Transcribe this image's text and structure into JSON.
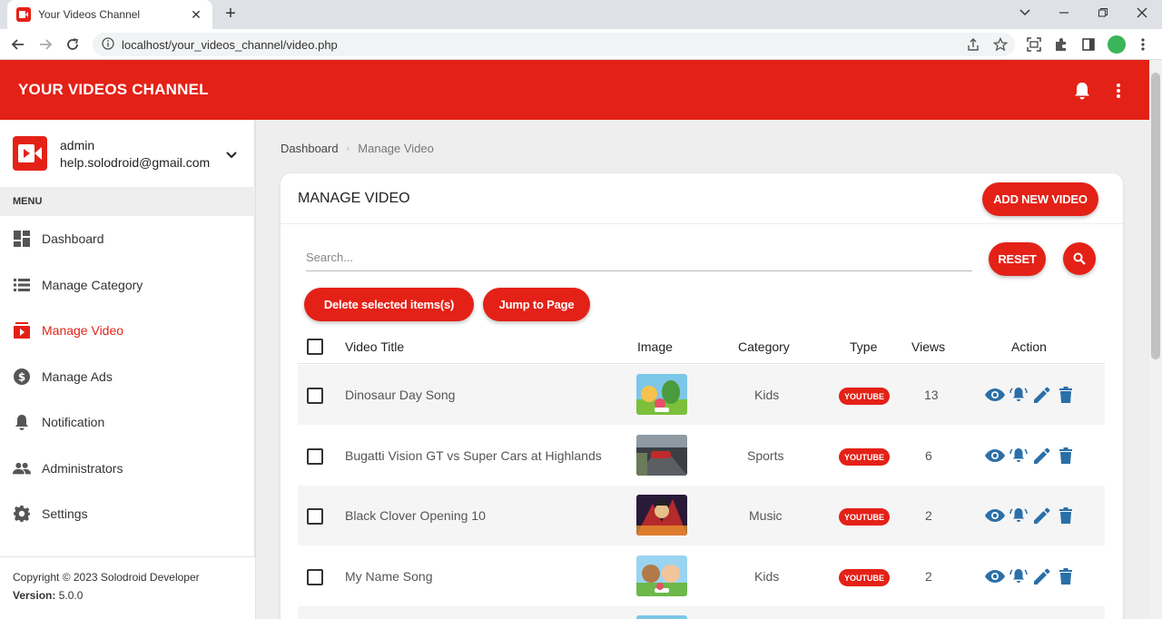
{
  "browser": {
    "tab_title": "Your Videos Channel",
    "url": "localhost/your_videos_channel/video.php"
  },
  "header": {
    "title": "YOUR VIDEOS CHANNEL"
  },
  "user": {
    "name": "admin",
    "email": "help.solodroid@gmail.com"
  },
  "sidebar": {
    "menu_header": "MENU",
    "items": [
      {
        "label": "Dashboard"
      },
      {
        "label": "Manage Category"
      },
      {
        "label": "Manage Video"
      },
      {
        "label": "Manage Ads"
      },
      {
        "label": "Notification"
      },
      {
        "label": "Administrators"
      },
      {
        "label": "Settings"
      }
    ],
    "footer": {
      "copyright": "Copyright © 2023 Solodroid Developer",
      "version_label": "Version:",
      "version": "5.0.0"
    }
  },
  "breadcrumb": {
    "home": "Dashboard",
    "current": "Manage Video"
  },
  "card": {
    "title": "MANAGE VIDEO",
    "add_button": "ADD NEW VIDEO",
    "search_placeholder": "Search...",
    "reset_button": "RESET",
    "delete_selected_button": "Delete selected items(s)",
    "jump_button": "Jump to Page"
  },
  "table": {
    "columns": [
      "Video Title",
      "Image",
      "Category",
      "Type",
      "Views",
      "Action"
    ],
    "rows": [
      {
        "title": "Dinosaur Day Song",
        "category": "Kids",
        "type": "YOUTUBE",
        "views": "13"
      },
      {
        "title": "Bugatti Vision GT vs Super Cars at Highlands",
        "category": "Sports",
        "type": "YOUTUBE",
        "views": "6"
      },
      {
        "title": "Black Clover Opening 10",
        "category": "Music",
        "type": "YOUTUBE",
        "views": "2"
      },
      {
        "title": "My Name Song",
        "category": "Kids",
        "type": "YOUTUBE",
        "views": "2"
      }
    ]
  },
  "colors": {
    "brand_red": "#e42117",
    "action_blue": "#2a6fa8"
  }
}
